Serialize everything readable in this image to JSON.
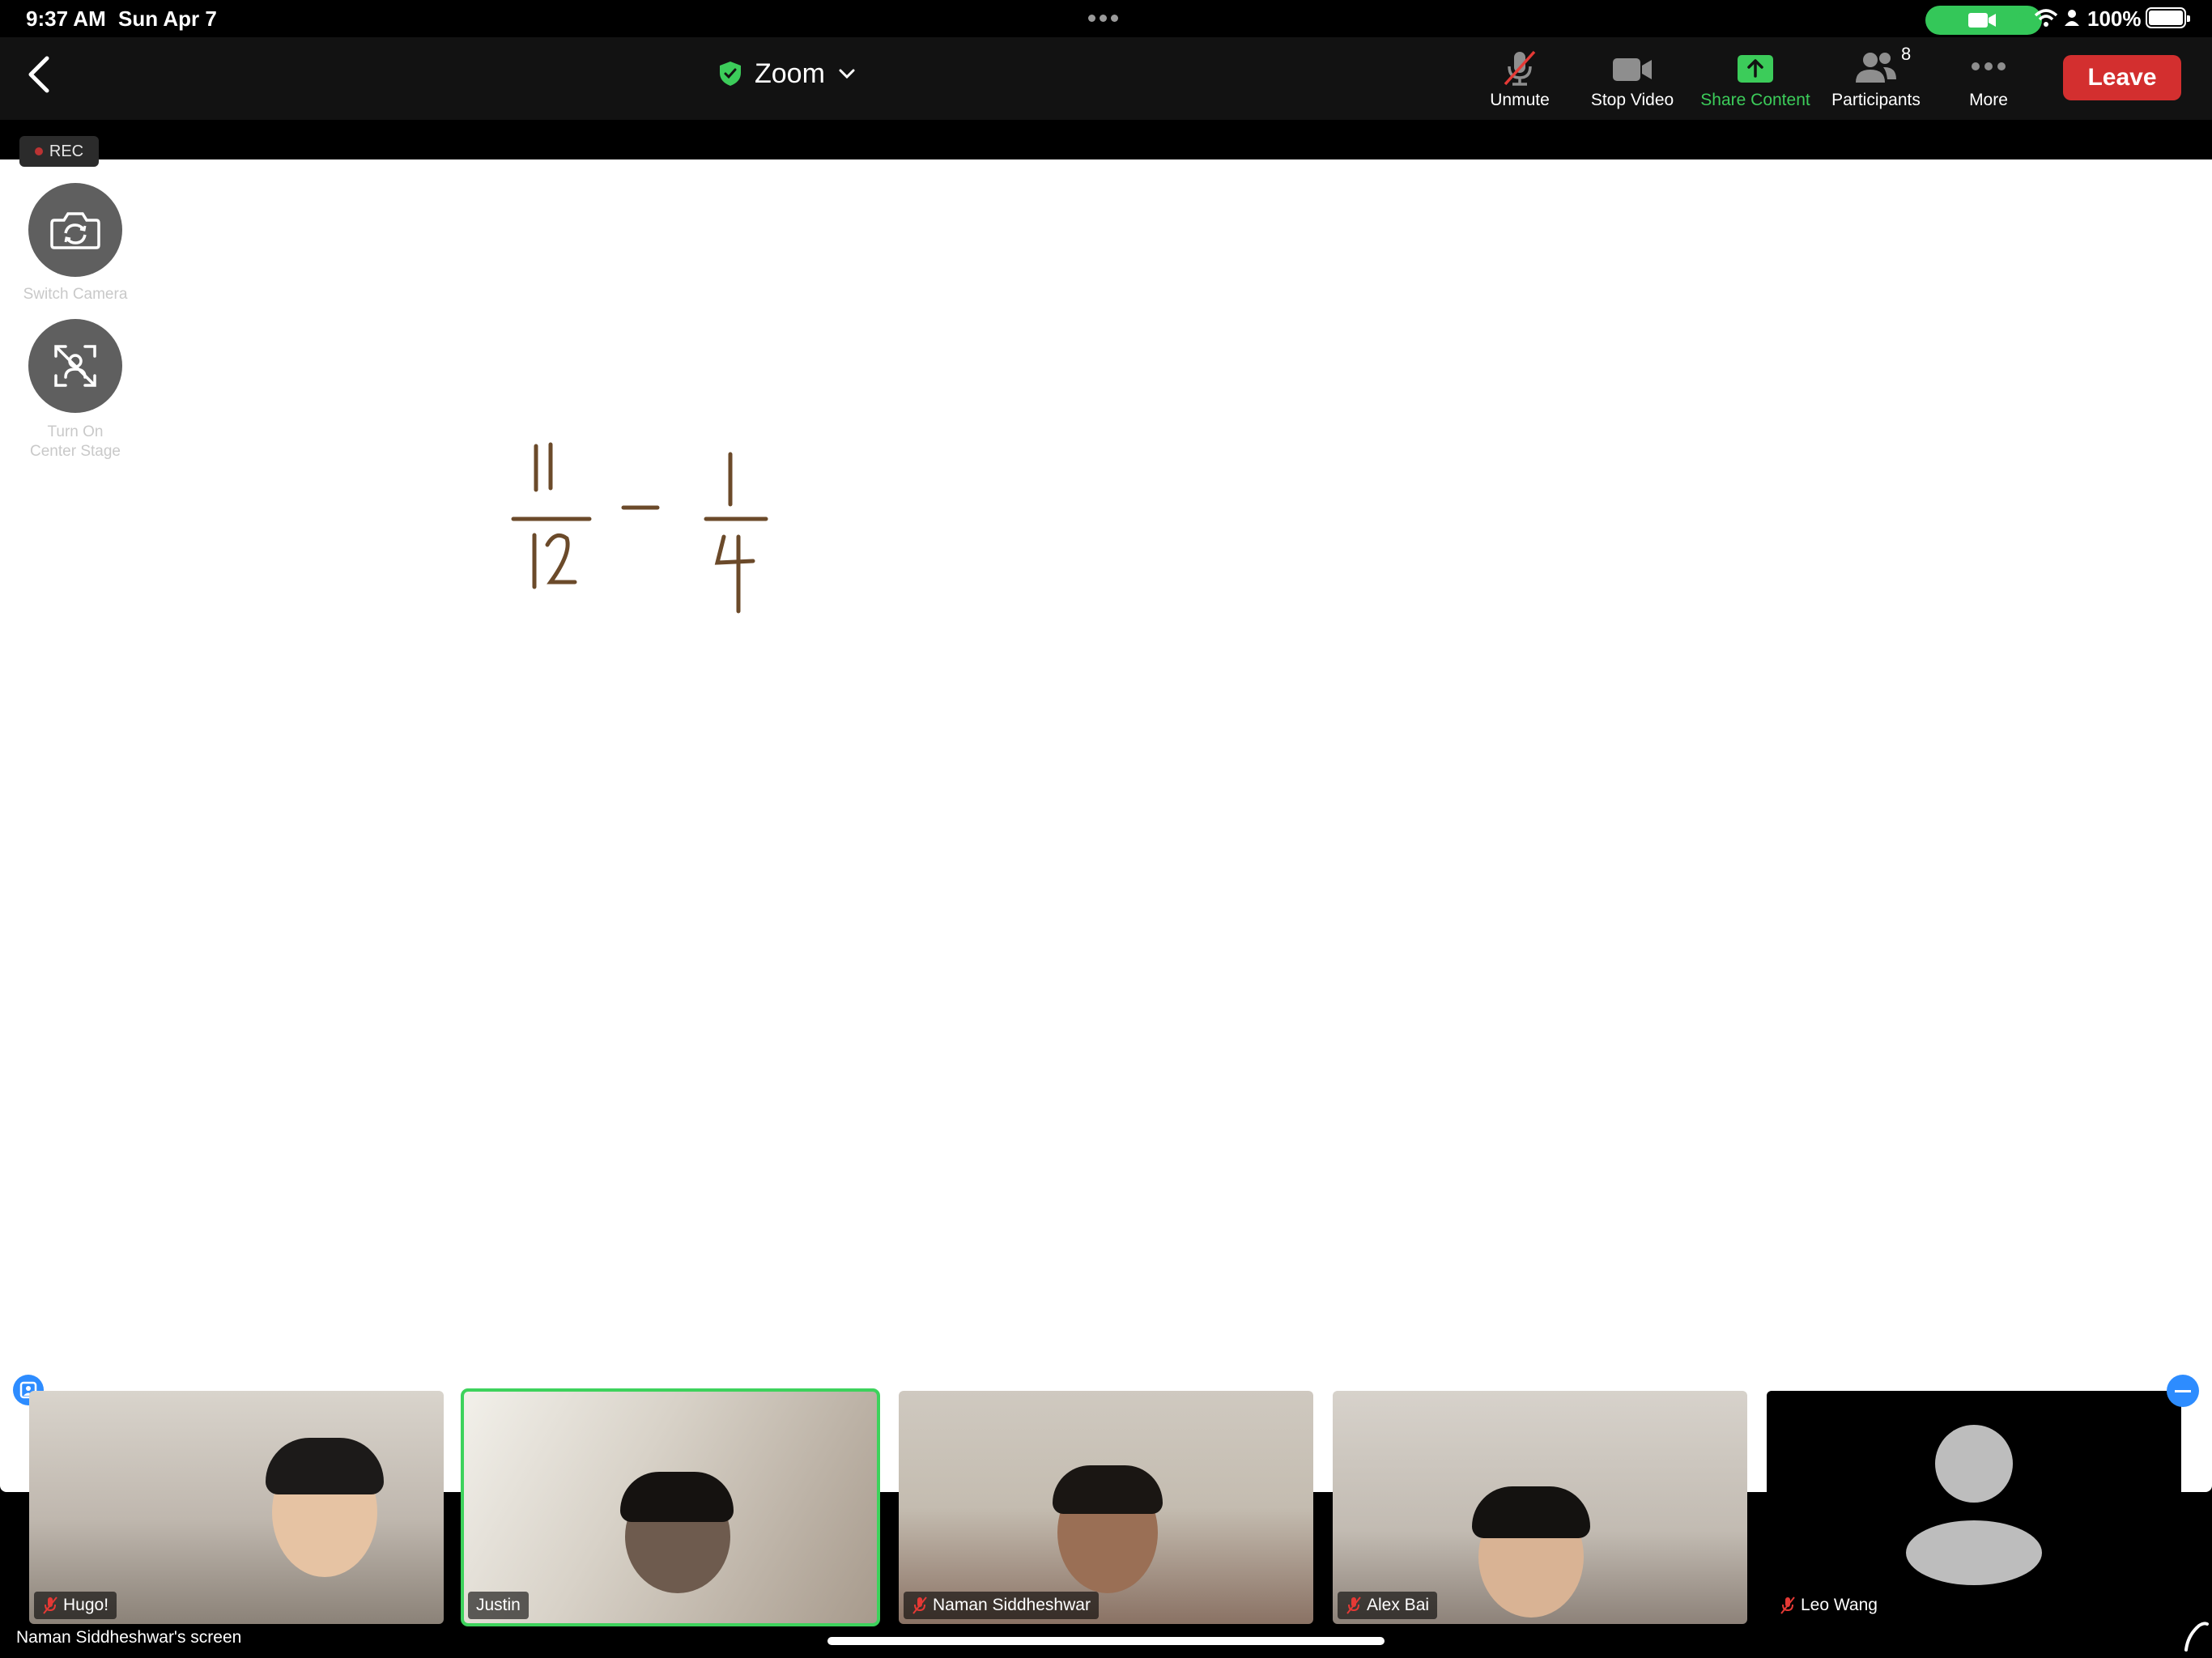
{
  "status_bar": {
    "time": "9:37 AM",
    "date": "Sun Apr 7",
    "battery": "100%"
  },
  "toolbar": {
    "title": "Zoom",
    "unmute_label": "Unmute",
    "stop_video_label": "Stop Video",
    "share_label": "Share Content",
    "participants_label": "Participants",
    "participant_count": "8",
    "more_label": "More",
    "leave_label": "Leave"
  },
  "recording": {
    "label": "REC"
  },
  "side_controls": {
    "switch_camera_label": "Switch Camera",
    "center_stage_line1": "Turn On",
    "center_stage_line2": "Center Stage"
  },
  "participants": [
    {
      "name": "Hugo!",
      "muted": true,
      "active": false
    },
    {
      "name": "Justin",
      "muted": false,
      "active": true
    },
    {
      "name": "Naman Siddheshwar",
      "muted": true,
      "active": false
    },
    {
      "name": "Alex Bai",
      "muted": true,
      "active": false
    },
    {
      "name": "Leo Wang",
      "muted": true,
      "active": false,
      "video_off": true
    }
  ],
  "footer": {
    "screen_owner_label": "Naman Siddheshwar's screen"
  },
  "colors": {
    "accent_green": "#3ccc5a",
    "leave_red": "#d32f2f",
    "pin_blue": "#2d8cff",
    "ink": "#6b4a2a"
  },
  "icons": {
    "back": "chevron-left-icon",
    "shield": "shield-check-icon",
    "mic": "mic-off-icon",
    "video": "video-camera-icon",
    "share": "share-up-arrow-icon",
    "participants": "people-icon",
    "more": "ellipsis-icon",
    "switch_camera": "camera-rotate-icon",
    "center_stage": "center-stage-off-icon"
  }
}
